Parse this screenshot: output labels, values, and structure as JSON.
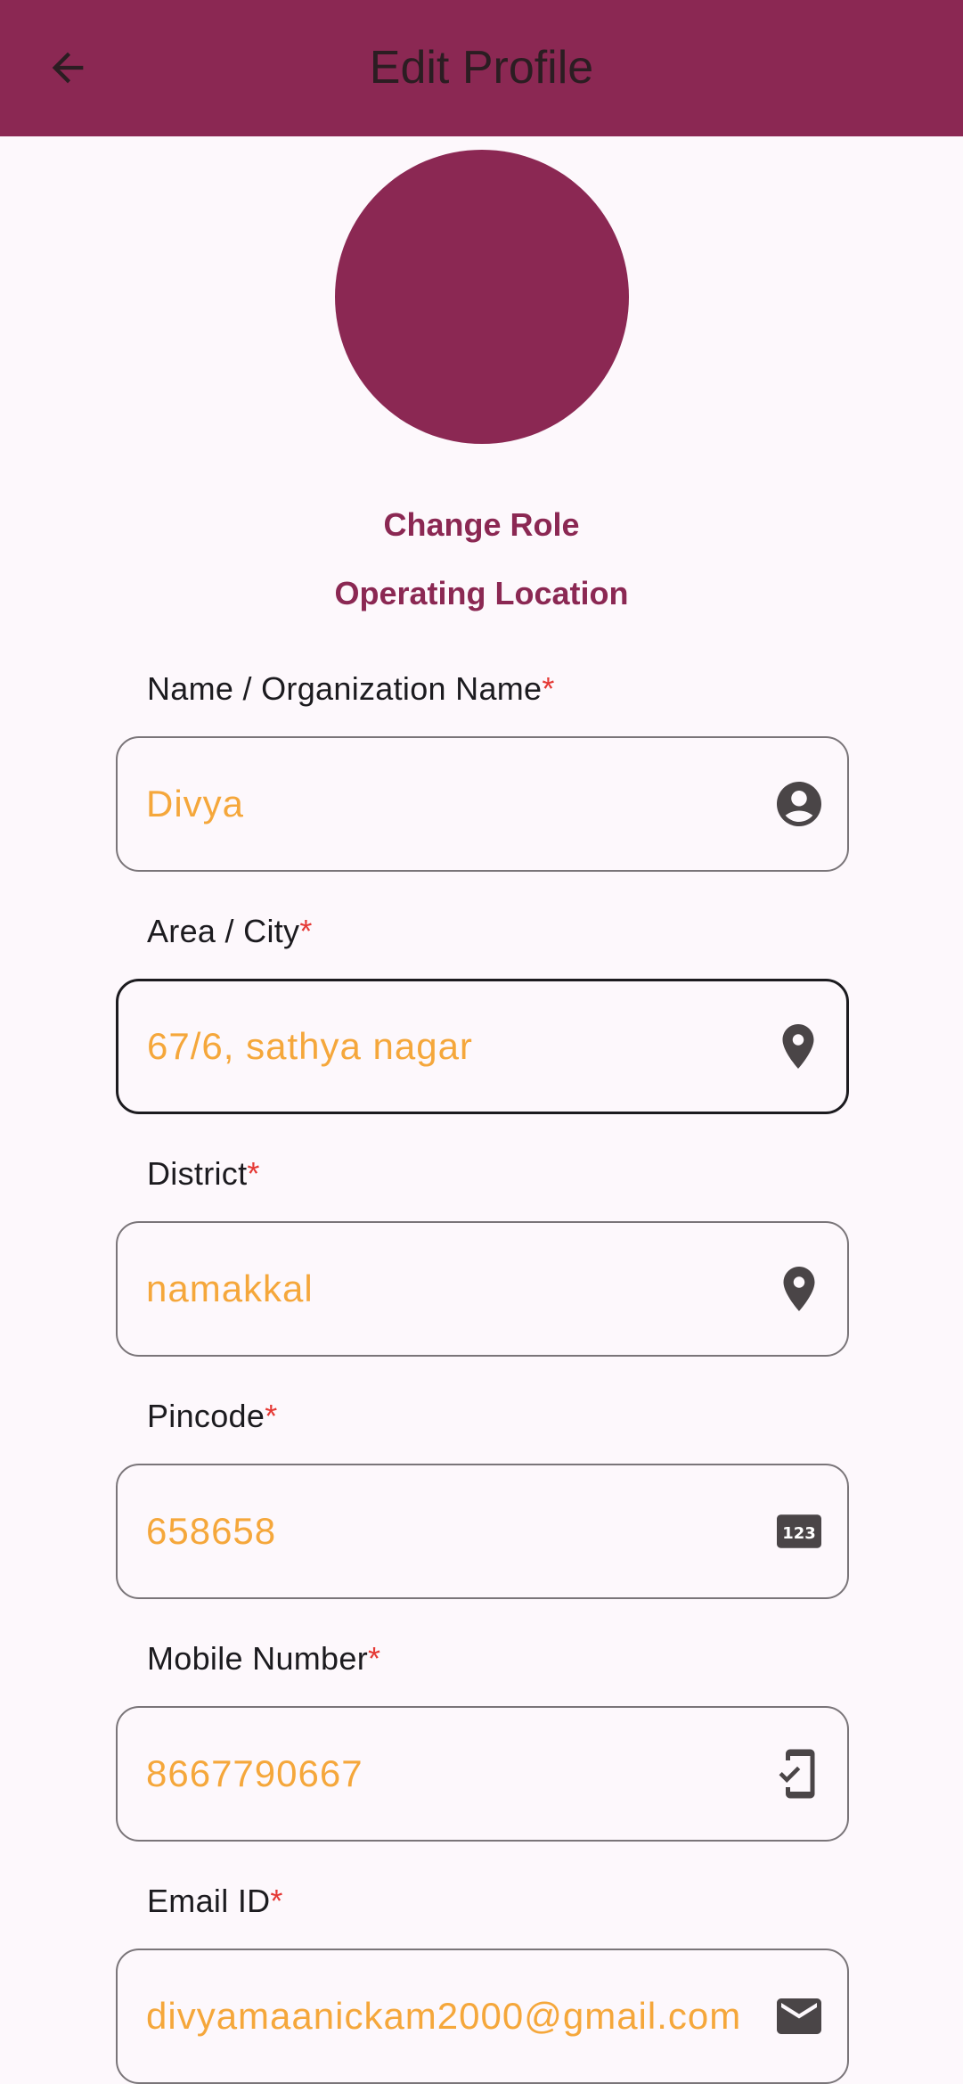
{
  "appbar": {
    "title": "Edit Profile",
    "back_icon": "arrow-back-icon"
  },
  "profile": {
    "avatar_color": "#8b2853"
  },
  "links": {
    "change_role": "Change Role",
    "operating_location": "Operating Location"
  },
  "fields": [
    {
      "label": "Name / Organization Name",
      "required": "*",
      "value": "Divya",
      "icon": "account-circle-icon"
    },
    {
      "label": "Area / City",
      "required": "*",
      "value": "67/6, sathya nagar",
      "icon": "location-pin-icon"
    },
    {
      "label": "District",
      "required": "*",
      "value": "namakkal",
      "icon": "location-pin-icon"
    },
    {
      "label": "Pincode",
      "required": "*",
      "value": "658658",
      "icon": "numbers-icon",
      "icon_text": "123"
    },
    {
      "label": "Mobile Number",
      "required": "*",
      "value": "8667790667",
      "icon": "phone-check-icon"
    },
    {
      "label": "Email ID",
      "required": "*",
      "value": "divyamaanickam2000@gmail.com",
      "icon": "email-icon"
    }
  ],
  "colors": {
    "primary": "#8b2853",
    "value_text": "#f5a73b",
    "required": "#e53935",
    "background": "#fdf8fc"
  }
}
